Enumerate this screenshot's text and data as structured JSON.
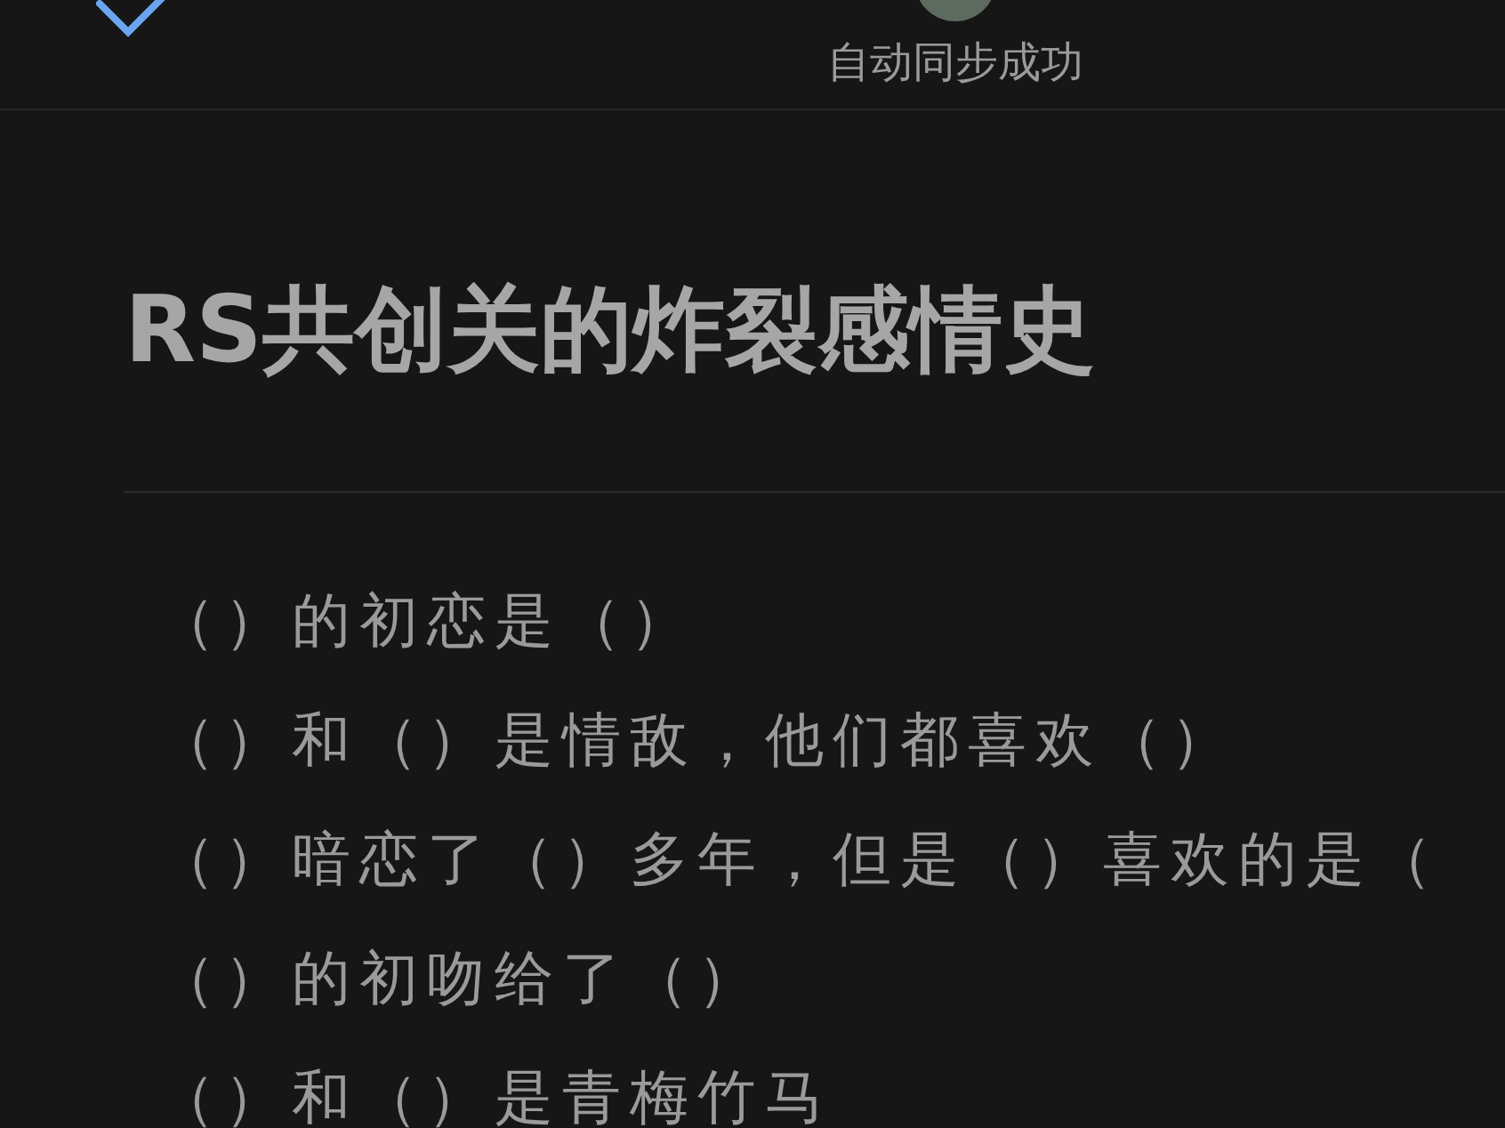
{
  "header": {
    "status": "自动同步成功"
  },
  "title": "RS共创关的炸裂感情史",
  "lines": [
    "（）的初恋是（）",
    "（）和（）是情敌，他们都喜欢（）",
    "（）暗恋了（）多年，但是（）喜欢的是（",
    "（）的初吻给了（）",
    "（）和（）是青梅竹马"
  ]
}
